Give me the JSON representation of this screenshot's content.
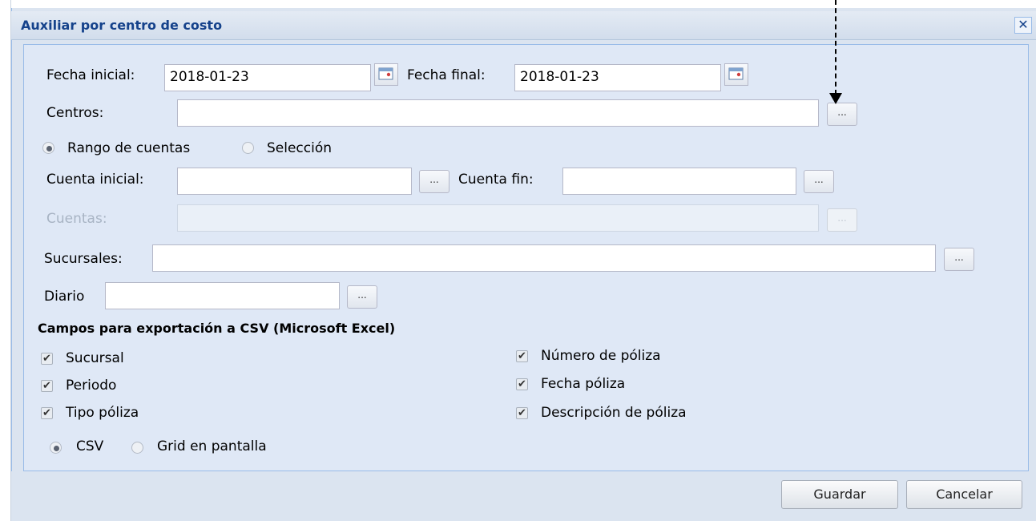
{
  "dialog": {
    "title": "Auxiliar por centro de costo",
    "close_symbol": "✕"
  },
  "form": {
    "fecha_inicial_label": "Fecha inicial:",
    "fecha_inicial_value": "2018-01-23",
    "fecha_final_label": "Fecha final:",
    "fecha_final_value": "2018-01-23",
    "centros_label": "Centros:",
    "centros_value": "",
    "radio_rango_label": "Rango de cuentas",
    "radio_seleccion_label": "Selección",
    "cuenta_inicial_label": "Cuenta inicial:",
    "cuenta_inicial_value": "",
    "cuenta_fin_label": "Cuenta fin:",
    "cuenta_fin_value": "",
    "cuentas_label": "Cuentas:",
    "cuentas_value": "",
    "sucursales_label": "Sucursales:",
    "sucursales_value": "",
    "diario_label": "Diario",
    "diario_value": "",
    "ellipsis": "..."
  },
  "csv": {
    "heading": "Campos para exportación a CSV (Microsoft Excel)",
    "checkmark": "✔",
    "left": [
      "Sucursal",
      "Periodo",
      "Tipo póliza"
    ],
    "right": [
      "Número de póliza",
      "Fecha póliza",
      "Descripción de póliza"
    ],
    "output_csv_label": "CSV",
    "output_grid_label": "Grid en pantalla"
  },
  "footer": {
    "save_label": "Guardar",
    "cancel_label": "Cancelar"
  },
  "icons": {
    "calendar": "calendar-icon",
    "close": "close-icon"
  },
  "colors": {
    "title": "#15428b",
    "panel": "#dfe8f6",
    "border": "#99bbe8"
  }
}
